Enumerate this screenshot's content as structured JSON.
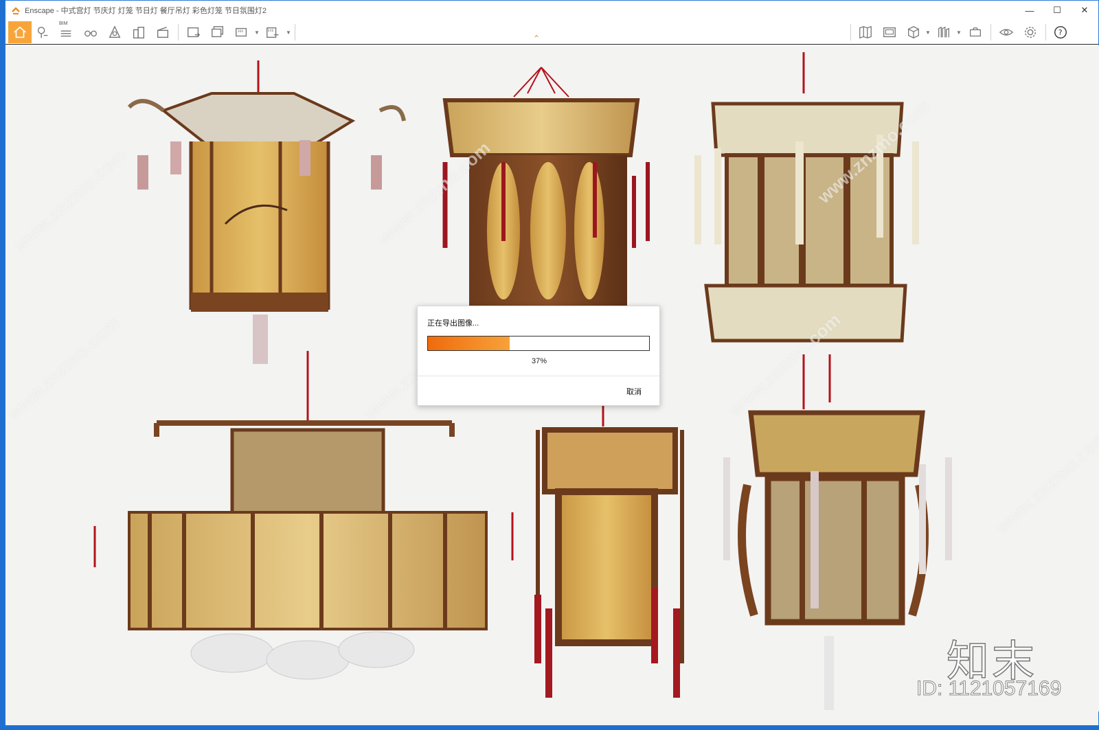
{
  "window": {
    "title": "Enscape - 中式宫灯 节庆灯 灯笼 节日灯 餐厅吊灯 彩色灯笼 节日氛围灯2"
  },
  "toolbar": {
    "bim_label": "BIM",
    "icons_left": [
      "home-icon",
      "asset-library-icon",
      "bim-icon",
      "binoculars-icon",
      "views-icon",
      "buildings-icon",
      "video-editor-icon",
      "screenshot-icon",
      "batch-render-icon",
      "panorama-360-icon",
      "export-exe-icon"
    ],
    "icons_right": [
      "map-icon",
      "visual-settings-panel-icon",
      "cube-view-icon",
      "material-library-icon",
      "capture-icon",
      "eye-icon",
      "gear-icon",
      "help-icon"
    ]
  },
  "dialog": {
    "title": "正在导出图像...",
    "progress_percent": 37,
    "progress_label": "37%",
    "cancel_label": "取消"
  },
  "watermarks": {
    "site": "www.znzmo.com",
    "brand": "知末",
    "id_text": "ID: 1121057169"
  },
  "colors": {
    "accent": "#f7a53b",
    "progress": "#f06b0c",
    "taskbar": "#1f6fd1"
  }
}
